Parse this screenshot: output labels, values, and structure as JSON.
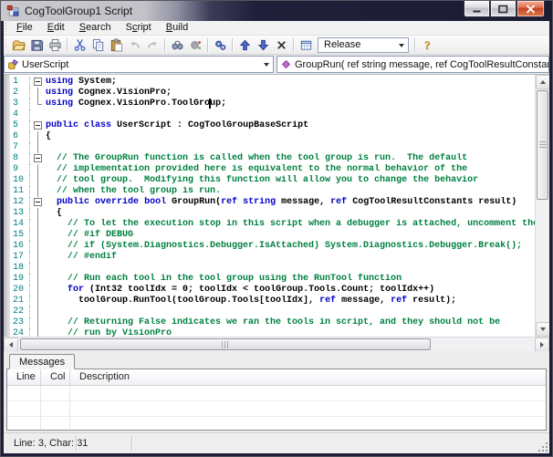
{
  "window": {
    "title": "CogToolGroup1 Script"
  },
  "menu": {
    "items": [
      {
        "pre": "",
        "u": "F",
        "post": "ile"
      },
      {
        "pre": "",
        "u": "E",
        "post": "dit"
      },
      {
        "pre": "",
        "u": "S",
        "post": "earch"
      },
      {
        "pre": "S",
        "u": "c",
        "post": "ript"
      },
      {
        "pre": "",
        "u": "B",
        "post": "uild"
      }
    ]
  },
  "toolbar": {
    "release": "Release",
    "icons": [
      "open",
      "save",
      "print",
      "cut",
      "copy",
      "paste",
      "undo",
      "redo",
      "find",
      "refresh",
      "build-gears",
      "move-up",
      "move-down",
      "delete",
      "grid",
      "help"
    ]
  },
  "navigator": {
    "class_name": "UserScript",
    "method_signature": "GroupRun( ref string message,  ref CogToolResultConstants result)"
  },
  "editor": {
    "lines": [
      {
        "n": 1,
        "f": "box",
        "s": [
          [
            "k",
            "using"
          ],
          [
            "p",
            " System;"
          ]
        ]
      },
      {
        "n": 2,
        "f": "line",
        "s": [
          [
            "k",
            "using"
          ],
          [
            "p",
            " Cognex.VisionPro;"
          ]
        ]
      },
      {
        "n": 3,
        "f": "corner",
        "s": [
          [
            "k",
            "using"
          ],
          [
            "p",
            " Cognex.VisionPro.ToolGro"
          ],
          [
            "t",
            ""
          ],
          [
            "p",
            "up;"
          ]
        ]
      },
      {
        "n": 4,
        "f": "none",
        "s": []
      },
      {
        "n": 5,
        "f": "box",
        "s": [
          [
            "k",
            "public"
          ],
          [
            "p",
            " "
          ],
          [
            "k",
            "class"
          ],
          [
            "p",
            " UserScript : CogToolGroupBaseScript"
          ]
        ]
      },
      {
        "n": 6,
        "f": "line",
        "s": [
          [
            "p",
            "{"
          ]
        ]
      },
      {
        "n": 7,
        "f": "line",
        "s": []
      },
      {
        "n": 8,
        "f": "box",
        "s": [
          [
            "c",
            "  // The GroupRun function is called when the tool group is run.  The default"
          ]
        ]
      },
      {
        "n": 9,
        "f": "line",
        "s": [
          [
            "c",
            "  // implementation provided here is equivalent to the normal behavior of the"
          ]
        ]
      },
      {
        "n": 10,
        "f": "line",
        "s": [
          [
            "c",
            "  // tool group.  Modifying this function will allow you to change the behavior"
          ]
        ]
      },
      {
        "n": 11,
        "f": "line",
        "s": [
          [
            "c",
            "  // when the tool group is run."
          ]
        ]
      },
      {
        "n": 12,
        "f": "box",
        "s": [
          [
            "p",
            "  "
          ],
          [
            "k",
            "public"
          ],
          [
            "p",
            " "
          ],
          [
            "k",
            "override"
          ],
          [
            "p",
            " "
          ],
          [
            "k",
            "bool"
          ],
          [
            "p",
            " GroupRun("
          ],
          [
            "k",
            "ref"
          ],
          [
            "p",
            " "
          ],
          [
            "k",
            "string"
          ],
          [
            "p",
            " message, "
          ],
          [
            "k",
            "ref"
          ],
          [
            "p",
            " CogToolResultConstants result)"
          ]
        ]
      },
      {
        "n": 13,
        "f": "line",
        "s": [
          [
            "p",
            "  {"
          ]
        ]
      },
      {
        "n": 14,
        "f": "line",
        "s": [
          [
            "c",
            "    // To let the execution stop in this script when a debugger is attached, uncomment the"
          ]
        ]
      },
      {
        "n": 15,
        "f": "line",
        "s": [
          [
            "c",
            "    // #if DEBUG"
          ]
        ]
      },
      {
        "n": 16,
        "f": "line",
        "s": [
          [
            "c",
            "    // if (System.Diagnostics.Debugger.IsAttached) System.Diagnostics.Debugger.Break();"
          ]
        ]
      },
      {
        "n": 17,
        "f": "line",
        "s": [
          [
            "c",
            "    // #endif"
          ]
        ]
      },
      {
        "n": 18,
        "f": "line",
        "s": []
      },
      {
        "n": 19,
        "f": "line",
        "s": [
          [
            "c",
            "    // Run each tool in the tool group using the RunTool function"
          ]
        ]
      },
      {
        "n": 20,
        "f": "line",
        "s": [
          [
            "p",
            "    "
          ],
          [
            "k",
            "for"
          ],
          [
            "p",
            " (Int32 toolIdx = 0; toolIdx < toolGroup.Tools.Count; toolIdx++)"
          ]
        ]
      },
      {
        "n": 21,
        "f": "line",
        "s": [
          [
            "p",
            "      toolGroup.RunTool(toolGroup.Tools[toolIdx], "
          ],
          [
            "k",
            "ref"
          ],
          [
            "p",
            " message, "
          ],
          [
            "k",
            "ref"
          ],
          [
            "p",
            " result);"
          ]
        ]
      },
      {
        "n": 22,
        "f": "line",
        "s": []
      },
      {
        "n": 23,
        "f": "line",
        "s": [
          [
            "c",
            "    // Returning False indicates we ran the tools in script, and they should not be"
          ]
        ]
      },
      {
        "n": 24,
        "f": "line",
        "s": [
          [
            "c",
            "    // run by VisionPro"
          ]
        ]
      }
    ]
  },
  "messages": {
    "tab_label": "Messages",
    "columns": [
      "Line",
      "Col",
      "Description"
    ],
    "rows": []
  },
  "statusbar": {
    "position": "Line: 3, Char: 31"
  },
  "colors": {
    "keyword": "#0000C8",
    "comment": "#008040",
    "line_number": "#007F7F",
    "title_dark": "#1e1e36",
    "close_button": "#c94f33"
  }
}
